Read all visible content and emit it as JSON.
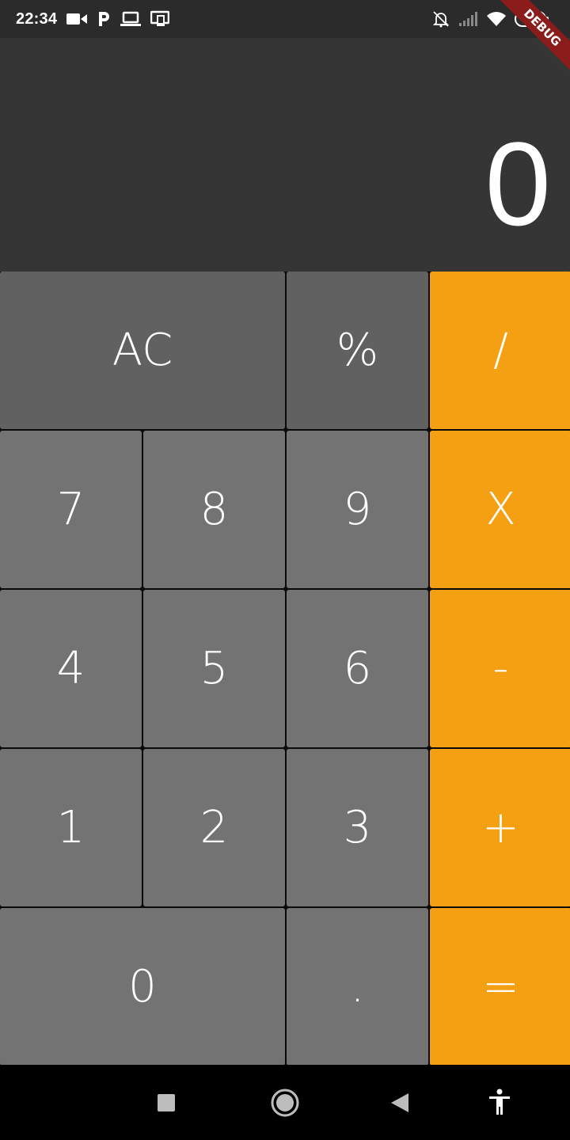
{
  "status_bar": {
    "time": "22:34",
    "battery": "40",
    "icons_left": [
      "video-icon",
      "p-app-icon",
      "laptop-icon",
      "cast-icon"
    ],
    "icons_right": [
      "bell-off-icon",
      "signal-icon",
      "wifi-icon",
      "battery-icon"
    ]
  },
  "debug_banner": "DEBUG",
  "display": {
    "value": "0"
  },
  "keys": {
    "clear": "AC",
    "percent": "%",
    "divide": "/",
    "seven": "7",
    "eight": "8",
    "nine": "9",
    "multiply": "X",
    "four": "4",
    "five": "5",
    "six": "6",
    "subtract": "-",
    "one": "1",
    "two": "2",
    "three": "3",
    "add": "+",
    "zero": "0",
    "decimal": ".",
    "equals": "="
  },
  "colors": {
    "display_bg": "#353535",
    "function_key": "#616161",
    "digit_key": "#737373",
    "operator_key": "#f5a012",
    "debug_ribbon": "#8b1c1c"
  },
  "nav_bar": {
    "icons": [
      "recent-apps-icon",
      "home-icon",
      "back-icon",
      "accessibility-icon"
    ]
  }
}
